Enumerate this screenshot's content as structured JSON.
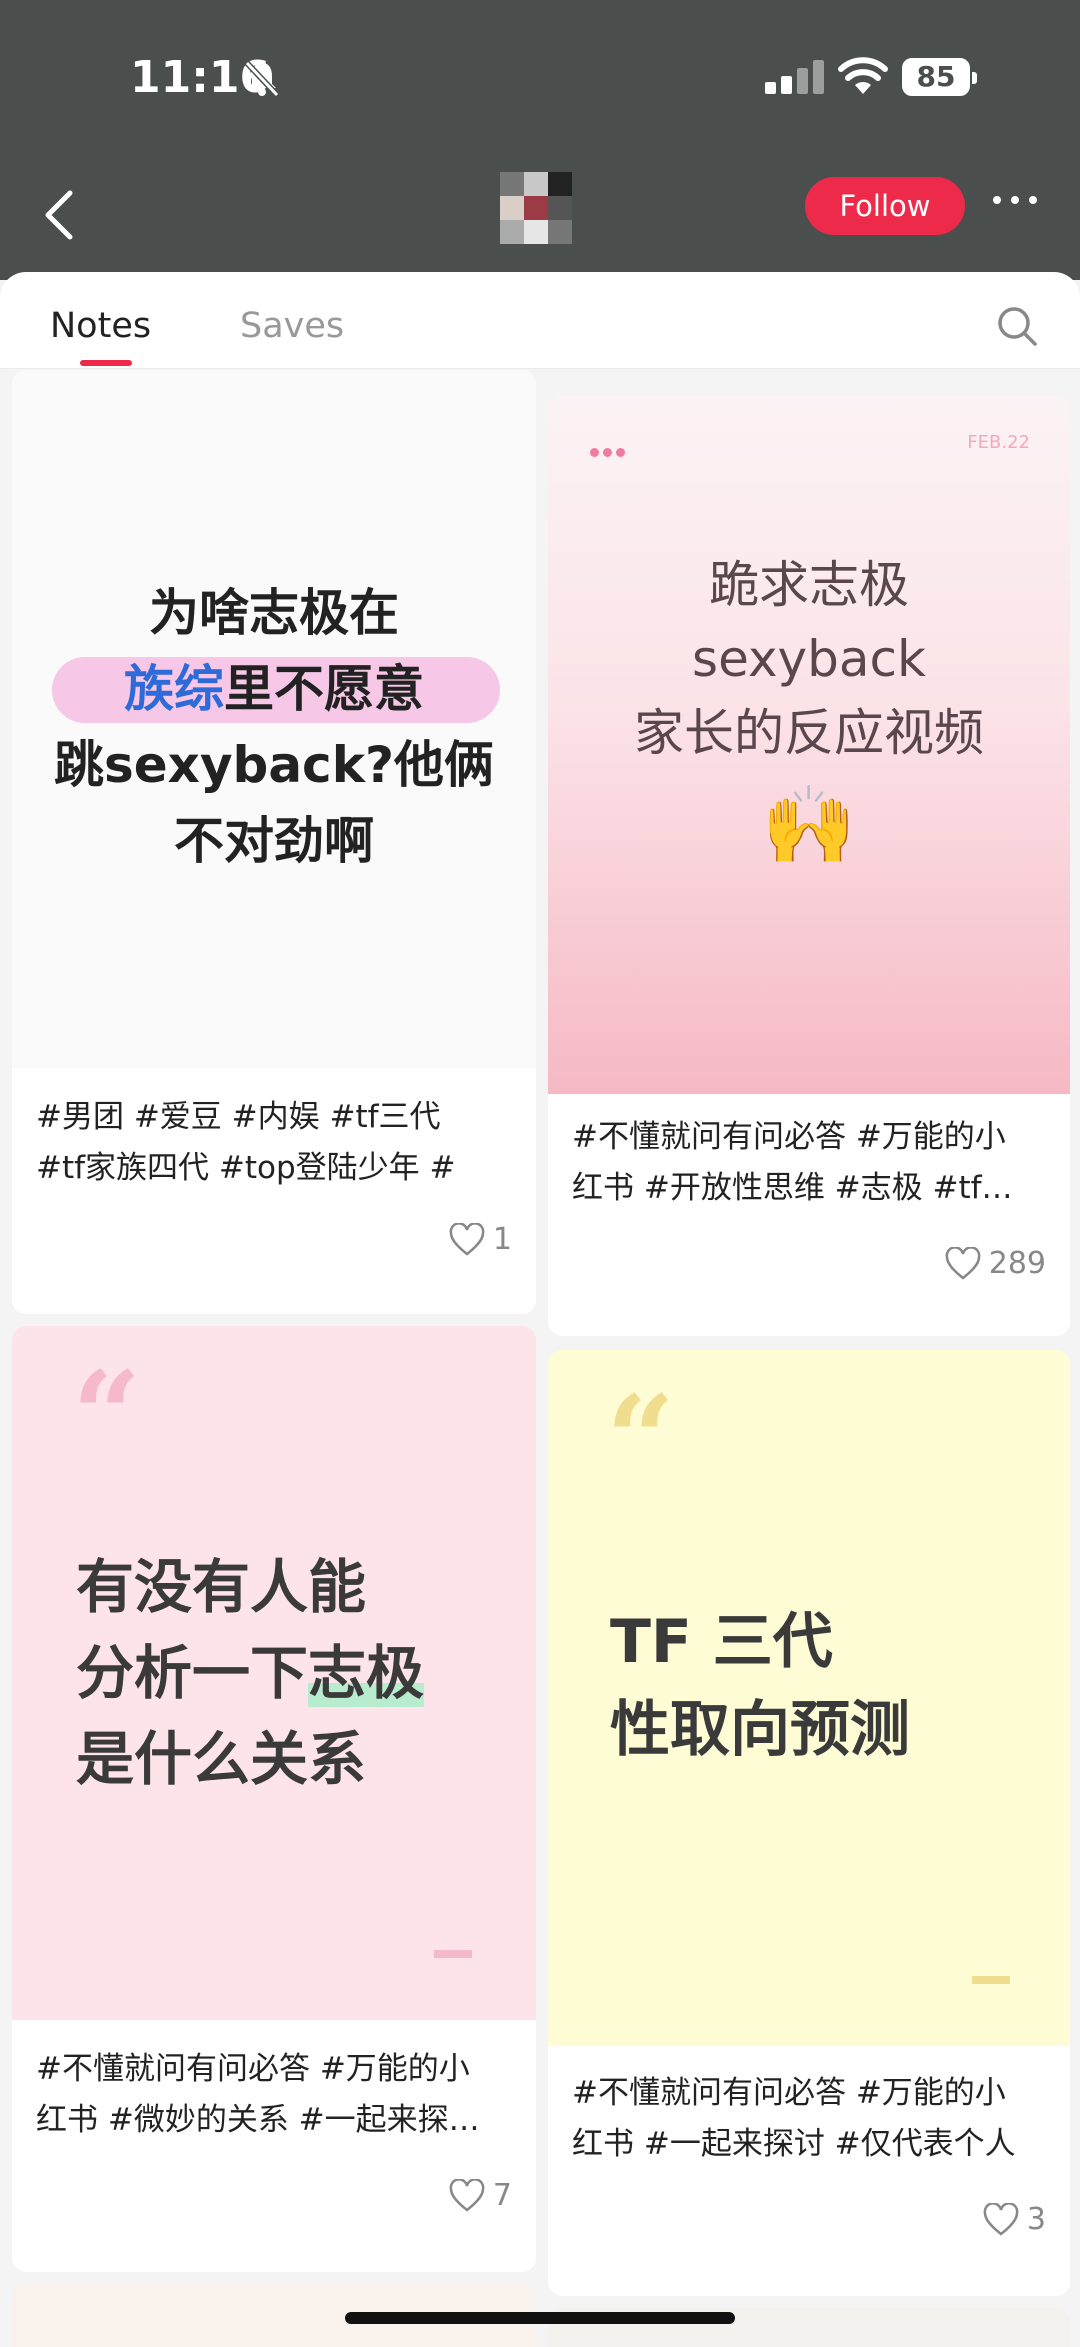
{
  "status_bar": {
    "time": "11:16",
    "battery": "85"
  },
  "header": {
    "follow_label": "Follow"
  },
  "tabs": [
    {
      "label": "Notes"
    },
    {
      "label": "Saves"
    }
  ],
  "notes": [
    {
      "cover_lines": [
        "为啥志极在",
        "族综里不愿意",
        "跳sexyback?他俩",
        "不对劲啊"
      ],
      "cover_highlight": "族综",
      "caption": "#男团 #爱豆 #内娱 #tf三代\n#tf家族四代 #top登陆少年 #",
      "likes": "1"
    },
    {
      "cover_date": "FEB.22",
      "cover_lines": [
        "跪求志极",
        "sexyback",
        "家长的反应视频"
      ],
      "cover_emoji": "🙌",
      "caption": "#不懂就问有问必答 #万能的小\n红书 #开放性思维 #志极 #tf…",
      "likes": "289"
    },
    {
      "cover_quote": "“",
      "cover_lines": [
        "有没有人能",
        "分析一下志极",
        "是什么关系"
      ],
      "caption": "#不懂就问有问必答 #万能的小\n红书 #微妙的关系 #一起来探…",
      "likes": "7"
    },
    {
      "cover_quote": "“",
      "cover_lines": [
        "TF 三代",
        "性取向预测"
      ],
      "caption": "#不懂就问有问必答 #万能的小\n红书 #一起来探讨 #仅代表个人",
      "likes": "3"
    }
  ],
  "colors": {
    "accent": "#ee2a4a",
    "header_bg": "#4a4f4e"
  }
}
